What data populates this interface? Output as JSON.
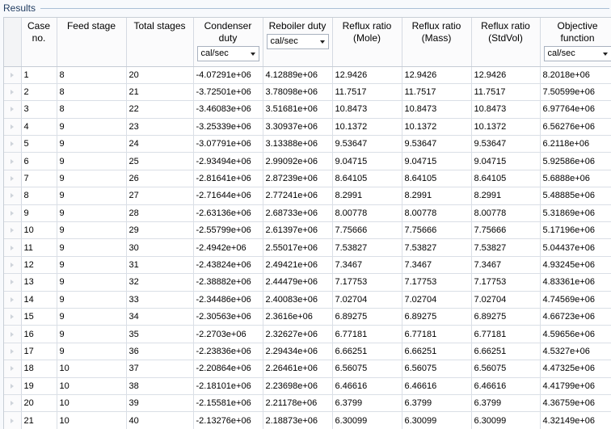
{
  "section": {
    "title": "Results"
  },
  "columns": [
    {
      "label": "Case no."
    },
    {
      "label": "Feed stage"
    },
    {
      "label": "Total stages"
    },
    {
      "label": "Condenser duty",
      "unit": "cal/sec"
    },
    {
      "label": "Reboiler duty",
      "unit": "cal/sec"
    },
    {
      "label": "Reflux ratio (Mole)"
    },
    {
      "label": "Reflux ratio (Mass)"
    },
    {
      "label": "Reflux ratio (StdVol)"
    },
    {
      "label": "Objective function",
      "unit": "cal/sec"
    }
  ],
  "rows": [
    [
      "1",
      "8",
      "20",
      "-4.07291e+06",
      "4.12889e+06",
      "12.9426",
      "12.9426",
      "12.9426",
      "8.2018e+06"
    ],
    [
      "2",
      "8",
      "21",
      "-3.72501e+06",
      "3.78098e+06",
      "11.7517",
      "11.7517",
      "11.7517",
      "7.50599e+06"
    ],
    [
      "3",
      "8",
      "22",
      "-3.46083e+06",
      "3.51681e+06",
      "10.8473",
      "10.8473",
      "10.8473",
      "6.97764e+06"
    ],
    [
      "4",
      "9",
      "23",
      "-3.25339e+06",
      "3.30937e+06",
      "10.1372",
      "10.1372",
      "10.1372",
      "6.56276e+06"
    ],
    [
      "5",
      "9",
      "24",
      "-3.07791e+06",
      "3.13388e+06",
      "9.53647",
      "9.53647",
      "9.53647",
      "6.2118e+06"
    ],
    [
      "6",
      "9",
      "25",
      "-2.93494e+06",
      "2.99092e+06",
      "9.04715",
      "9.04715",
      "9.04715",
      "5.92586e+06"
    ],
    [
      "7",
      "9",
      "26",
      "-2.81641e+06",
      "2.87239e+06",
      "8.64105",
      "8.64105",
      "8.64105",
      "5.6888e+06"
    ],
    [
      "8",
      "9",
      "27",
      "-2.71644e+06",
      "2.77241e+06",
      "8.2991",
      "8.2991",
      "8.2991",
      "5.48885e+06"
    ],
    [
      "9",
      "9",
      "28",
      "-2.63136e+06",
      "2.68733e+06",
      "8.00778",
      "8.00778",
      "8.00778",
      "5.31869e+06"
    ],
    [
      "10",
      "9",
      "29",
      "-2.55799e+06",
      "2.61397e+06",
      "7.75666",
      "7.75666",
      "7.75666",
      "5.17196e+06"
    ],
    [
      "11",
      "9",
      "30",
      "-2.4942e+06",
      "2.55017e+06",
      "7.53827",
      "7.53827",
      "7.53827",
      "5.04437e+06"
    ],
    [
      "12",
      "9",
      "31",
      "-2.43824e+06",
      "2.49421e+06",
      "7.3467",
      "7.3467",
      "7.3467",
      "4.93245e+06"
    ],
    [
      "13",
      "9",
      "32",
      "-2.38882e+06",
      "2.44479e+06",
      "7.17753",
      "7.17753",
      "7.17753",
      "4.83361e+06"
    ],
    [
      "14",
      "9",
      "33",
      "-2.34486e+06",
      "2.40083e+06",
      "7.02704",
      "7.02704",
      "7.02704",
      "4.74569e+06"
    ],
    [
      "15",
      "9",
      "34",
      "-2.30563e+06",
      "2.3616e+06",
      "6.89275",
      "6.89275",
      "6.89275",
      "4.66723e+06"
    ],
    [
      "16",
      "9",
      "35",
      "-2.2703e+06",
      "2.32627e+06",
      "6.77181",
      "6.77181",
      "6.77181",
      "4.59656e+06"
    ],
    [
      "17",
      "9",
      "36",
      "-2.23836e+06",
      "2.29434e+06",
      "6.66251",
      "6.66251",
      "6.66251",
      "4.5327e+06"
    ],
    [
      "18",
      "10",
      "37",
      "-2.20864e+06",
      "2.26461e+06",
      "6.56075",
      "6.56075",
      "6.56075",
      "4.47325e+06"
    ],
    [
      "19",
      "10",
      "38",
      "-2.18101e+06",
      "2.23698e+06",
      "6.46616",
      "6.46616",
      "6.46616",
      "4.41799e+06"
    ],
    [
      "20",
      "10",
      "39",
      "-2.15581e+06",
      "2.21178e+06",
      "6.3799",
      "6.3799",
      "6.3799",
      "4.36759e+06"
    ],
    [
      "21",
      "10",
      "40",
      "-2.13276e+06",
      "2.18873e+06",
      "6.30099",
      "6.30099",
      "6.30099",
      "4.32149e+06"
    ]
  ]
}
